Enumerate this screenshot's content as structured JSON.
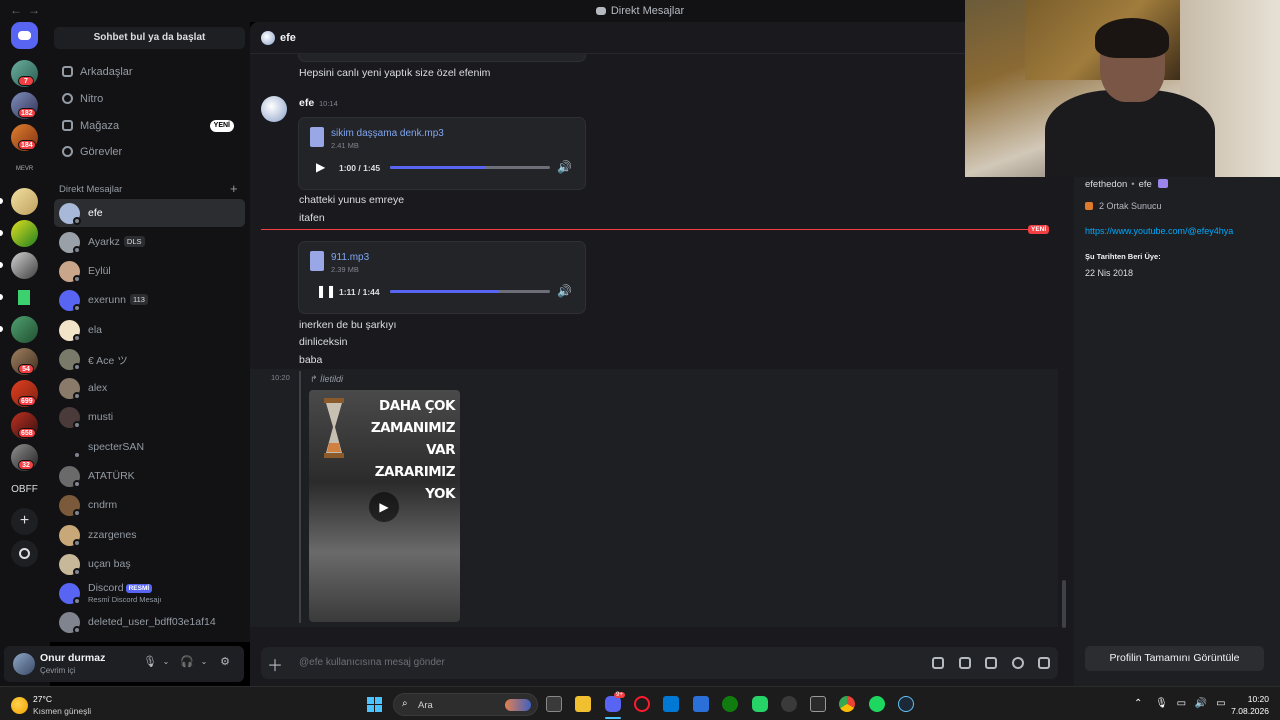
{
  "window": {
    "title": "Direkt Mesajlar",
    "back": "←",
    "forward": "→"
  },
  "servers": [
    {
      "badge": "7"
    },
    {
      "badge": "182"
    },
    {
      "badge": "184"
    },
    {
      "label": "MEVR"
    },
    {
      "badge": ""
    },
    {
      "badge": ""
    },
    {
      "badge": ""
    },
    {
      "badge": ""
    },
    {
      "badge": ""
    },
    {
      "badge": "54"
    },
    {
      "badge": "699"
    },
    {
      "badge": "658"
    },
    {
      "badge": "32"
    },
    {
      "label": "OBFF"
    }
  ],
  "sidebar": {
    "search_label": "Sohbet bul ya da başlat",
    "nav": [
      {
        "label": "Arkadaşlar"
      },
      {
        "label": "Nitro"
      },
      {
        "label": "Mağaza",
        "badge": "YENİ"
      },
      {
        "label": "Görevler"
      }
    ],
    "dm_header": "Direkt Mesajlar",
    "dm_add": "+",
    "dms": [
      {
        "name": "efe",
        "color": "#a8b8d8"
      },
      {
        "name": "Ayarkz",
        "tag": "DLS",
        "color": "#9aa0a8"
      },
      {
        "name": "Eylül",
        "color": "#c9a58a"
      },
      {
        "name": "exerunn",
        "tag": "113",
        "color": "#5865f2"
      },
      {
        "name": "ela",
        "color": "#f2e4c8"
      },
      {
        "name": "€ Ace ツ",
        "color": "#7a7a6a"
      },
      {
        "name": "alex",
        "color": "#8a7a6a"
      },
      {
        "name": "musti",
        "color": "#4a3a3a"
      },
      {
        "name": "specterSAN",
        "color": "#121214"
      },
      {
        "name": "ATATÜRK",
        "color": "#6a6a6a"
      },
      {
        "name": "cndrm",
        "color": "#7a5a3a"
      },
      {
        "name": "zzargenes",
        "color": "#c8a878"
      },
      {
        "name": "uçan baş",
        "color": "#c8b89a"
      },
      {
        "name": "Discord",
        "badge": "RESMİ",
        "sub": "Resmî Discord Mesajı",
        "color": "#5865f2"
      },
      {
        "name": "deleted_user_bdff03e1af14",
        "color": "#80848e"
      }
    ]
  },
  "user": {
    "name": "Onur durmaz",
    "status": "Çevrim içi"
  },
  "chat": {
    "channel": "efe",
    "messages": {
      "m0": "Hepsini canlı yeni yaptık size özel efenim",
      "author": "efe",
      "time": "10:14",
      "audio1": {
        "name": "sikim daşşama denk.mp3",
        "size": "2.41 MB",
        "time": "1:00 / 1:45",
        "progress": 0.6
      },
      "m1": "chatteki yunus emreye",
      "m2": "itafen",
      "new_label": "YENİ",
      "audio2": {
        "name": "911.mp3",
        "size": "2.39 MB",
        "time": "1:11 / 1:44",
        "progress": 0.68
      },
      "m3": "inerken de bu şarkıyı",
      "m4": "dinliceksin",
      "m5": "baba",
      "fwd_time": "10:20",
      "fwd_label": "İletildi",
      "video_caption": "DAHA ÇOK ZAMANIMIZ VAR ZARARIMIZ YOK"
    },
    "composer_placeholder": "@efe kullanıcısına mesaj gönder"
  },
  "profile": {
    "username": "efethedon",
    "display": "efe",
    "mutual": "2 Ortak Sunucu",
    "link": "https://www.youtube.com/@efey4hya",
    "since_label": "Şu Tarihten Beri Üye:",
    "since_value": "22 Nis 2018",
    "full_button": "Profilin Tamamını Görüntüle"
  },
  "taskbar": {
    "temp": "27°C",
    "weather": "Kısmen güneşli",
    "search": "Ara",
    "time": "10:20",
    "date": "7.08.2026",
    "discord_badge": "9+"
  }
}
